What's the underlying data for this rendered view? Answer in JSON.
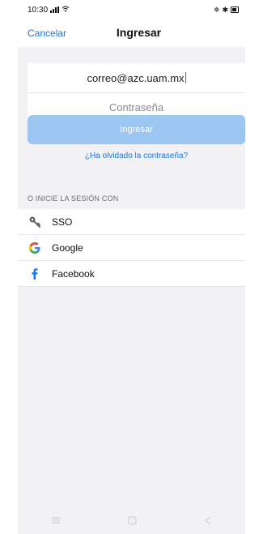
{
  "status_bar": {
    "time": "10:30"
  },
  "nav": {
    "cancel_label": "Cancelar",
    "title": "Ingresar"
  },
  "form": {
    "email_value": "correo@azc.uam.mx",
    "password_placeholder": "Contraseña",
    "submit_label": "Ingresar",
    "forgot_label": "¿Ha olvidado la contraseña?"
  },
  "social": {
    "section_label": "O INICIE LA SESIÓN CON",
    "items": [
      {
        "label": "SSO",
        "icon": "key-icon"
      },
      {
        "label": "Google",
        "icon": "google-icon"
      },
      {
        "label": "Facebook",
        "icon": "facebook-icon"
      }
    ]
  },
  "system_nav": {
    "icons": [
      "menu-icon",
      "home-icon",
      "back-icon"
    ]
  },
  "colors": {
    "accent": "#1a73e8",
    "button_disabled": "#9cc7f2",
    "background": "#f2f2f4"
  }
}
